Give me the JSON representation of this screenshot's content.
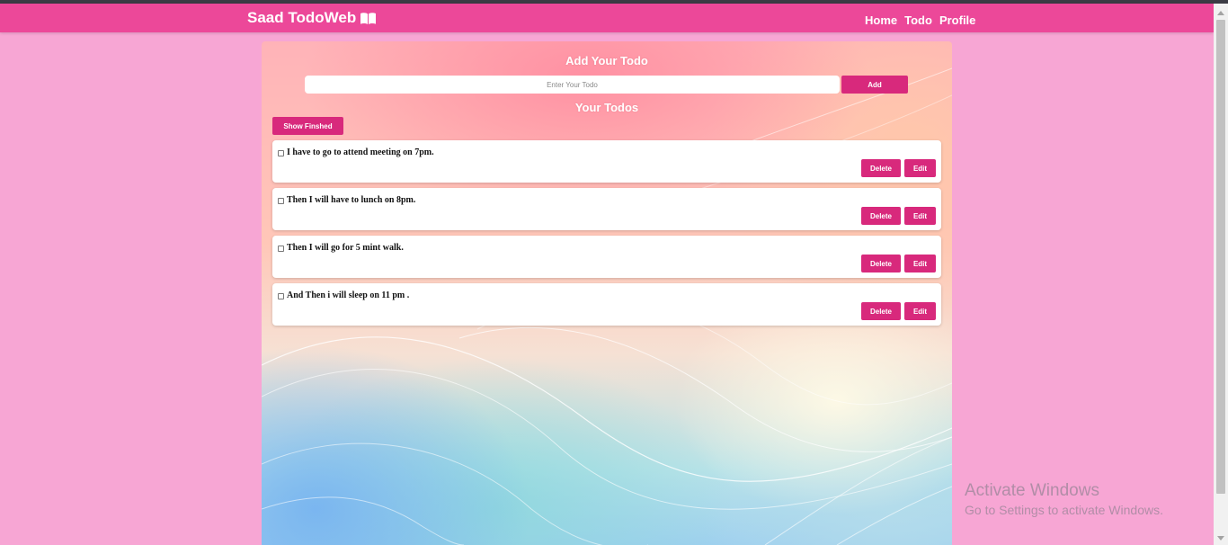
{
  "navbar": {
    "brand": "Saad TodoWeb",
    "brand_icon": "book-open-icon",
    "links": [
      "Home",
      "Todo",
      "Profile"
    ]
  },
  "form": {
    "heading": "Add Your Todo",
    "input_placeholder": "Enter Your Todo",
    "input_value": "",
    "add_label": "Add"
  },
  "list": {
    "heading": "Your Todos",
    "show_finished_label": "Show Finshed",
    "items": [
      {
        "text": "I have to go to attend meeting on 7pm.",
        "done": false,
        "delete_label": "Delete",
        "edit_label": "Edit"
      },
      {
        "text": "Then I will have to lunch on 8pm.",
        "done": false,
        "delete_label": "Delete",
        "edit_label": "Edit"
      },
      {
        "text": "Then I will go for 5 mint walk.",
        "done": false,
        "delete_label": "Delete",
        "edit_label": "Edit"
      },
      {
        "text": "And Then i will sleep on 11 pm .",
        "done": false,
        "delete_label": "Delete",
        "edit_label": "Edit"
      }
    ]
  },
  "watermark": {
    "line1": "Activate Windows",
    "line2": "Go to Settings to activate Windows."
  },
  "colors": {
    "page_bg": "#f7a6d4",
    "navbar": "#ec4899",
    "button": "#d8297c"
  }
}
